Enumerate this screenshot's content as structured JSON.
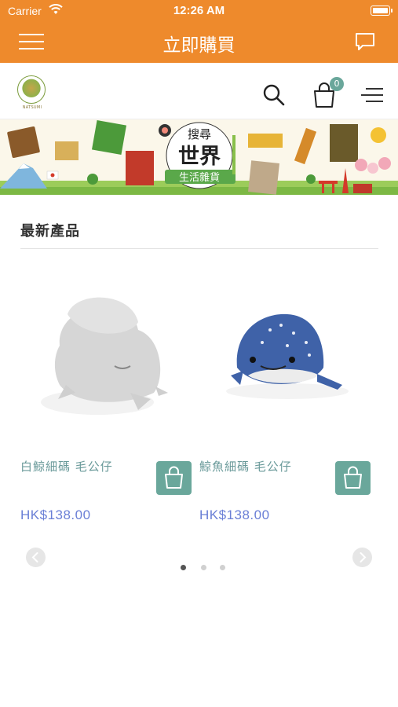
{
  "status_bar": {
    "carrier": "Carrier",
    "time": "12:26 AM"
  },
  "nav": {
    "title": "立即購買",
    "menu_icon": "hamburger-icon",
    "chat_icon": "chat-bubble-icon"
  },
  "header": {
    "logo_text": "NATSUMI",
    "cart_count": "0",
    "icons": [
      "search-icon",
      "shopping-bag-icon",
      "menu-icon"
    ]
  },
  "banner": {
    "text_line1": "搜尋",
    "text_line2": "世界",
    "text_line3": "生活雜貨"
  },
  "section": {
    "title": "最新產品"
  },
  "products": [
    {
      "name": "白鯨細碼 毛公仔",
      "price": "HK$138.00"
    },
    {
      "name": "鯨魚細碼 毛公仔",
      "price": "HK$138.00"
    }
  ],
  "slider": {
    "dot_count": 3,
    "active_index": 0
  },
  "colors": {
    "brand_orange": "#ee8a2c",
    "accent_teal": "#6aa79b",
    "price_blue": "#6a7fd6"
  }
}
